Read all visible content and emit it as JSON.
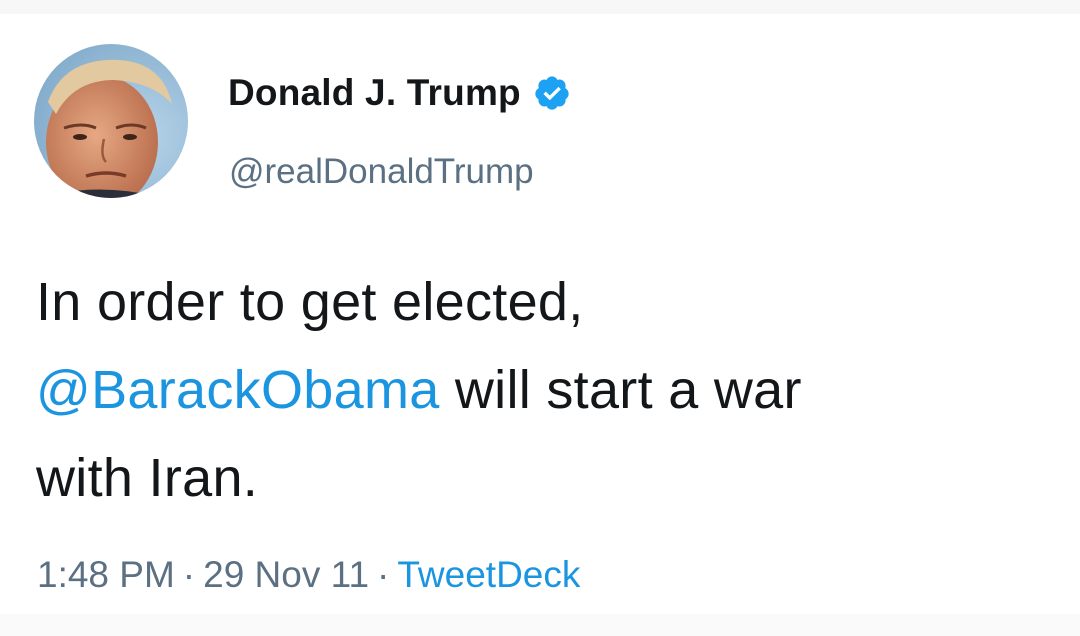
{
  "tweet": {
    "author": {
      "display_name": "Donald J. Trump",
      "handle": "@realDonaldTrump",
      "verified_icon": "verified-badge-icon",
      "avatar_icon": "profile-avatar"
    },
    "text": {
      "line1": "In order to get elected,",
      "mention": "@BarackObama",
      "after_mention": " will start a war",
      "line3": "with Iran."
    },
    "meta": {
      "time": "1:48 PM",
      "separator": "·",
      "date": "29 Nov 11",
      "source": "TweetDeck"
    }
  },
  "colors": {
    "text": "#14171a",
    "secondary": "#5b7083",
    "link": "#1b95e0",
    "verified": "#1da1f2"
  }
}
